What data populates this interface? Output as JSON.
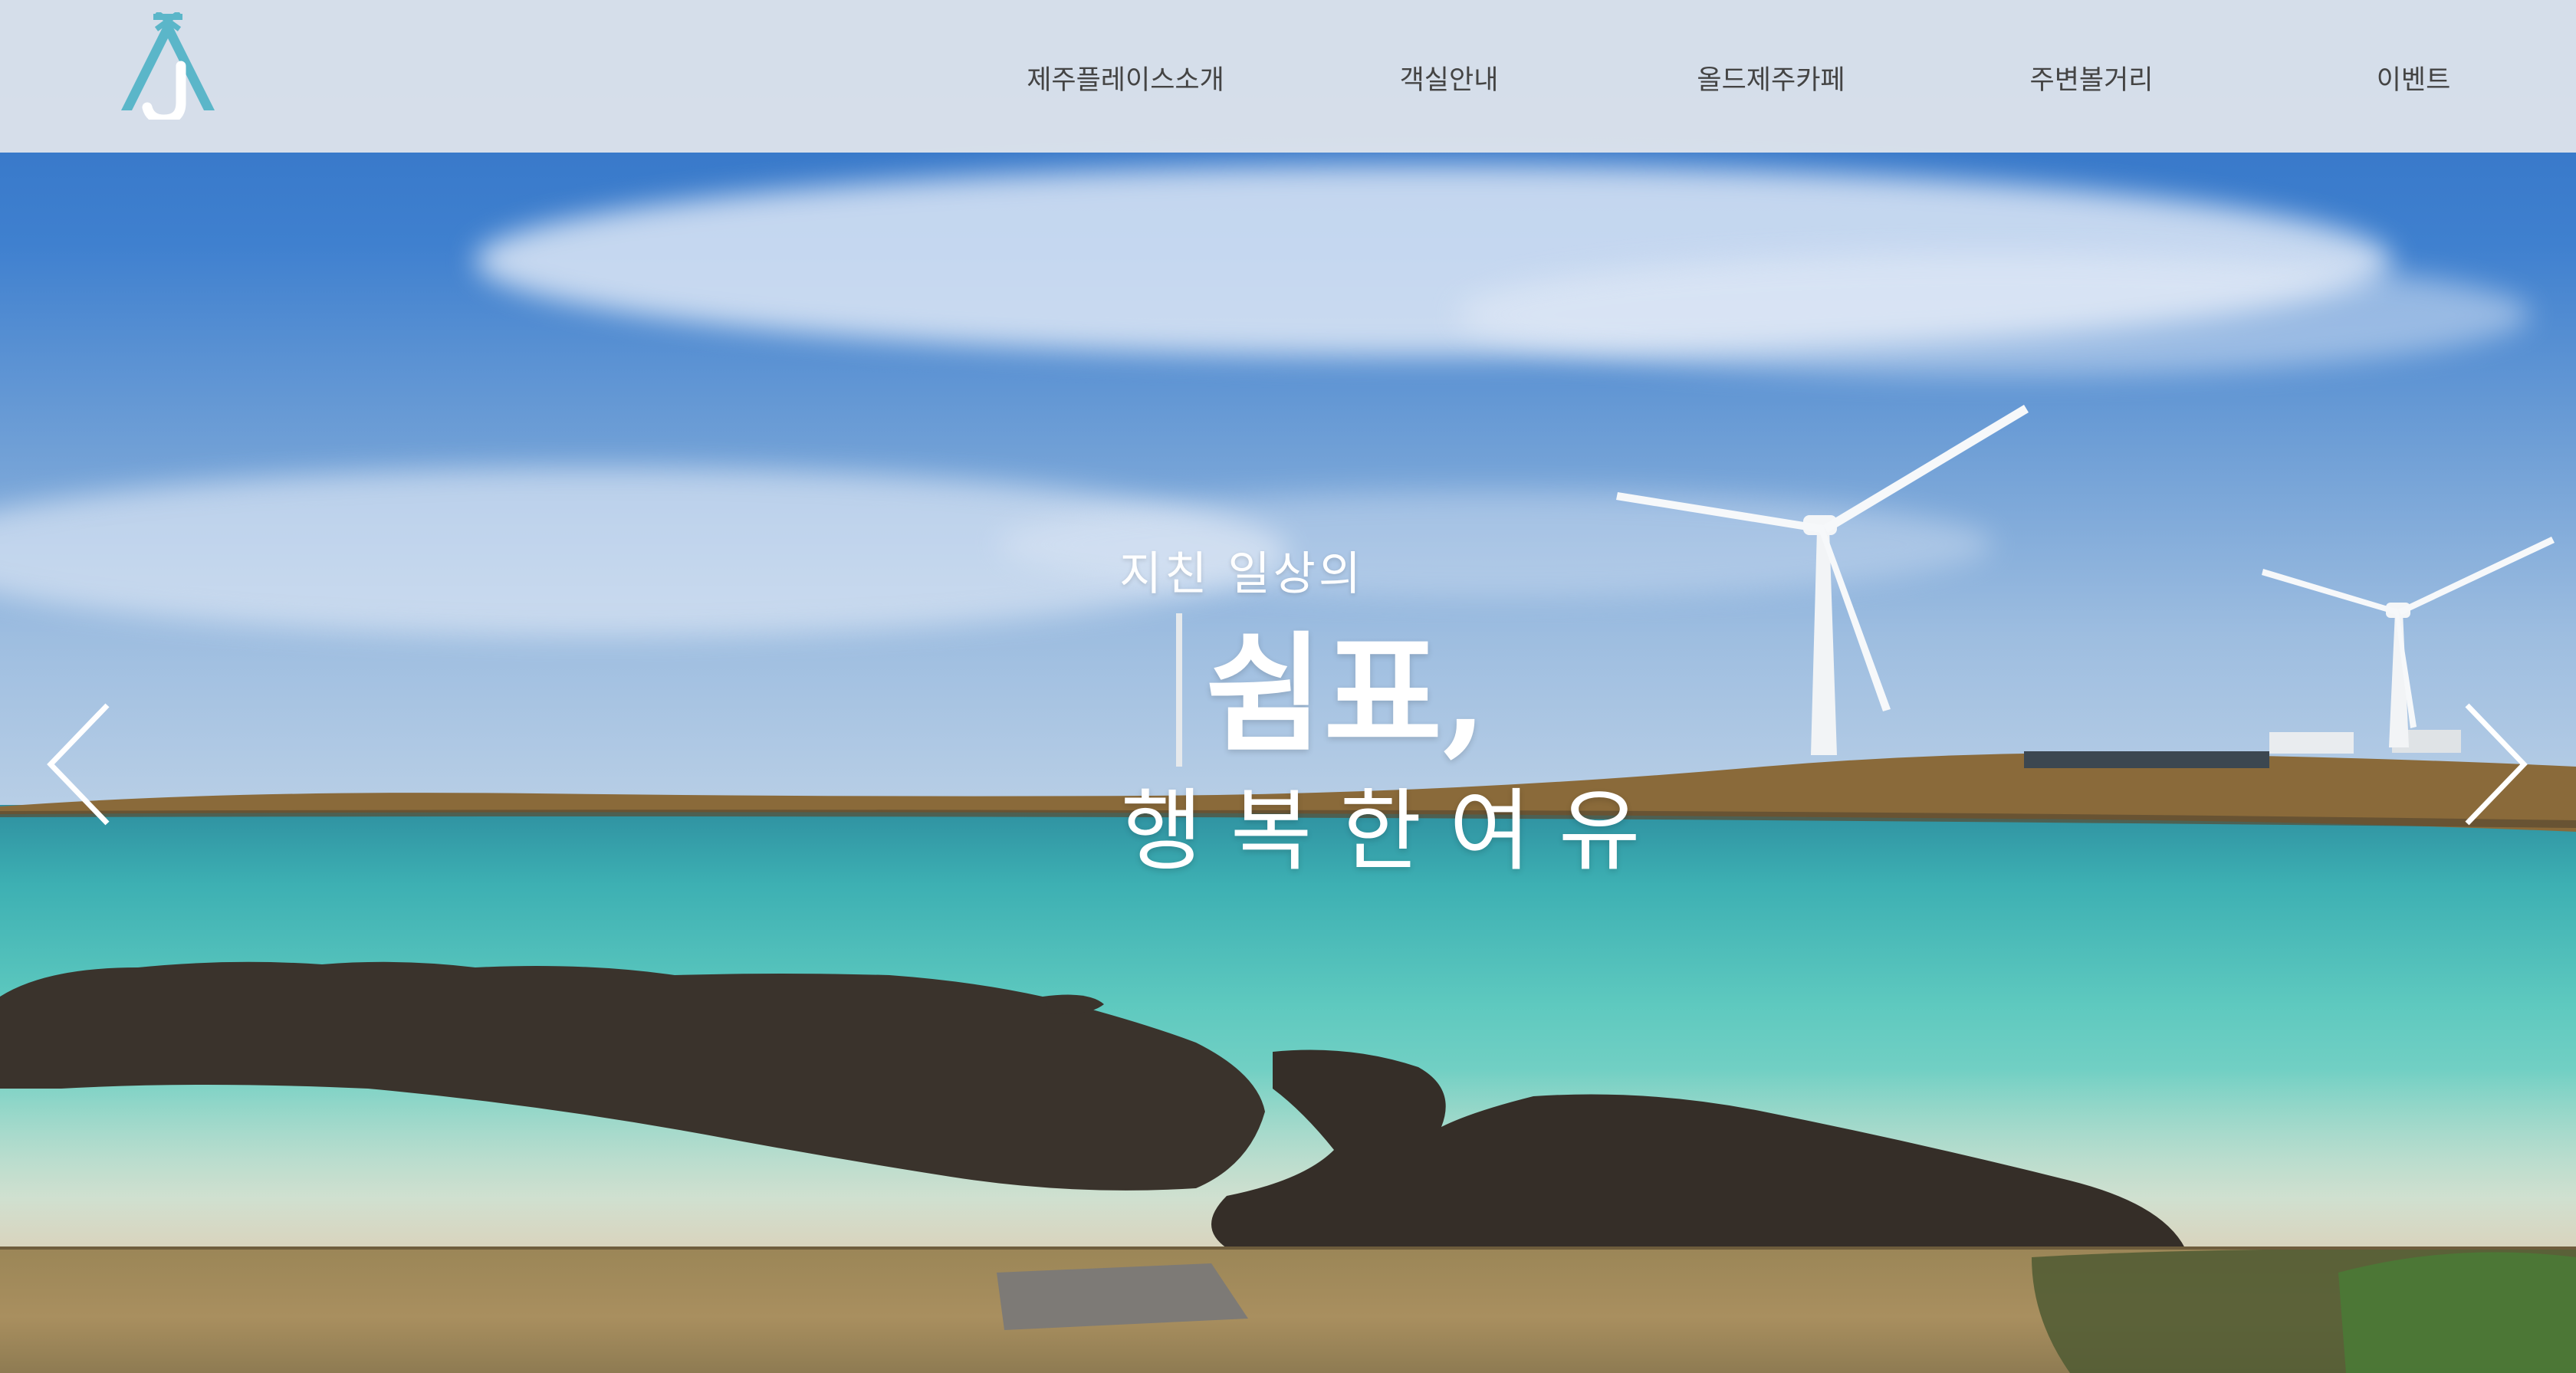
{
  "header": {
    "logo_letter": "J",
    "nav": [
      {
        "label": "제주플레이스소개"
      },
      {
        "label": "객실안내"
      },
      {
        "label": "올드제주카페"
      },
      {
        "label": "주변볼거리"
      },
      {
        "label": "이벤트"
      }
    ]
  },
  "hero": {
    "subtitle": "지친 일상의",
    "title": "쉼표,",
    "tagline": "행복한여유",
    "prev_icon": "chevron-left-icon",
    "next_icon": "chevron-right-icon"
  },
  "colors": {
    "header_bg": "#e2e6ed",
    "nav_text": "#444444",
    "logo_accent": "#5bb6c9",
    "hero_text": "#ffffff"
  }
}
